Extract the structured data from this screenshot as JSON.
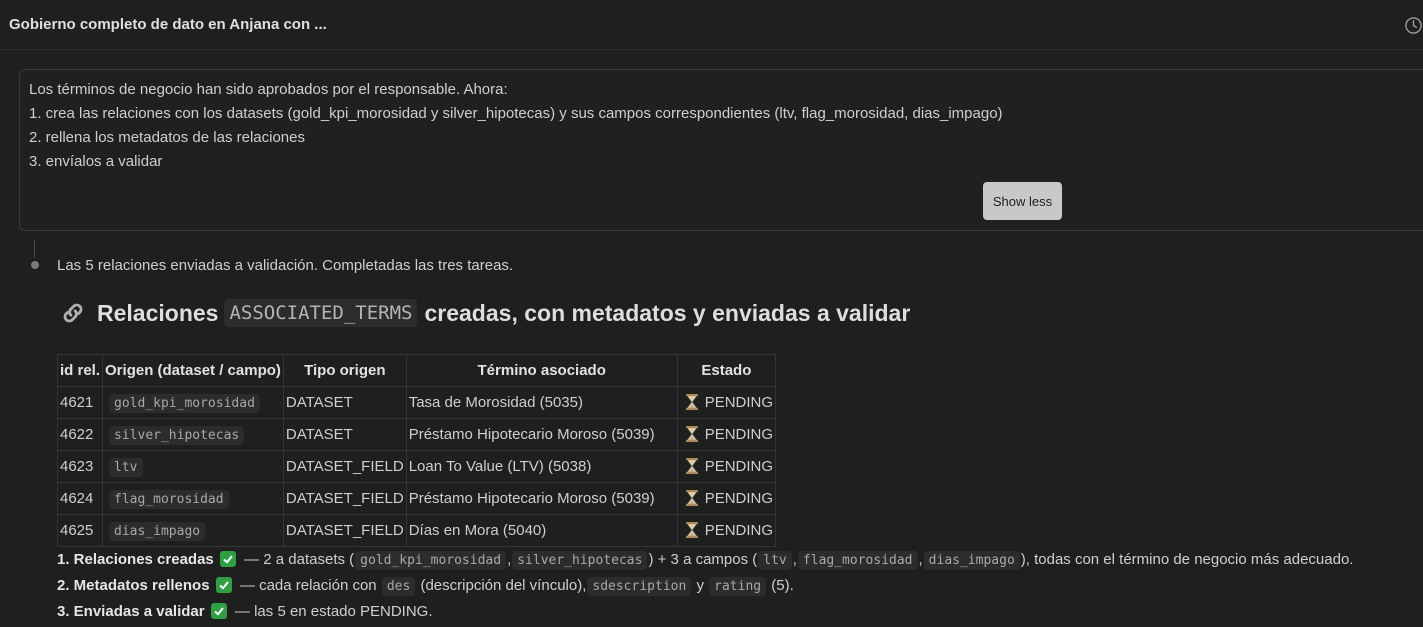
{
  "header": {
    "title": "Gobierno completo de dato en Anjana con ...",
    "history_icon": "clock-icon"
  },
  "prompt": {
    "lines": [
      "Los términos de negocio han sido aprobados por el responsable. Ahora:",
      "1.  crea las relaciones con los datasets (gold_kpi_morosidad y silver_hipotecas)  y sus campos correspondientes (ltv, flag_morosidad, dias_impago)",
      "2. rellena los metadatos de las relaciones",
      "3. envíalos a validar"
    ],
    "show_less_label": "Show less"
  },
  "response": {
    "status_text": "Las 5 relaciones enviadas a validación. Completadas las tres tareas.",
    "heading": {
      "icon": "link-icon",
      "before": "Relaciones",
      "code": "ASSOCIATED_TERMS",
      "after": "creadas, con metadatos y enviadas a validar"
    },
    "table": {
      "columns": [
        "id rel.",
        "Origen (dataset / campo)",
        "Tipo origen",
        "Término asociado",
        "Estado"
      ],
      "rows": [
        {
          "id": "4621",
          "origin": "gold_kpi_morosidad",
          "type": "DATASET",
          "term": "Tasa de Morosidad (5035)",
          "status": "PENDING"
        },
        {
          "id": "4622",
          "origin": "silver_hipotecas",
          "type": "DATASET",
          "term": "Préstamo Hipotecario Moroso (5039)",
          "status": "PENDING"
        },
        {
          "id": "4623",
          "origin": "ltv",
          "type": "DATASET_FIELD",
          "term": "Loan To Value (LTV) (5038)",
          "status": "PENDING"
        },
        {
          "id": "4624",
          "origin": "flag_morosidad",
          "type": "DATASET_FIELD",
          "term": "Préstamo Hipotecario Moroso (5039)",
          "status": "PENDING"
        },
        {
          "id": "4625",
          "origin": "dias_impago",
          "type": "DATASET_FIELD",
          "term": "Días en Mora (5040)",
          "status": "PENDING"
        }
      ],
      "status_icon": "hourglass-icon"
    },
    "summary": {
      "item1": {
        "label": "1. Relaciones creadas",
        "t1": " — 2 a datasets (",
        "c1": "gold_kpi_morosidad",
        "t2": ",",
        "c2": "silver_hipotecas",
        "t3": ") + 3 a campos (",
        "c3": "ltv",
        "t4": ",",
        "c4": "flag_morosidad",
        "t5": ",",
        "c5": "dias_impago",
        "t6": "), todas con el término de negocio más adecuado."
      },
      "item2": {
        "label": "2. Metadatos rellenos",
        "t1": " — cada relación con ",
        "c1": "des",
        "t2": " (descripción del vínculo),",
        "c2": "sdescription",
        "t3": " y ",
        "c3": "rating",
        "t4": " (5)."
      },
      "item3": {
        "label": "3. Enviadas a validar",
        "t1": " — las 5 en estado PENDING."
      },
      "check_icon": "check-mark-icon"
    }
  },
  "colors": {
    "background": "#1f1f1f",
    "check_green": "#2ea043",
    "hourglass": "#c9a86a"
  }
}
